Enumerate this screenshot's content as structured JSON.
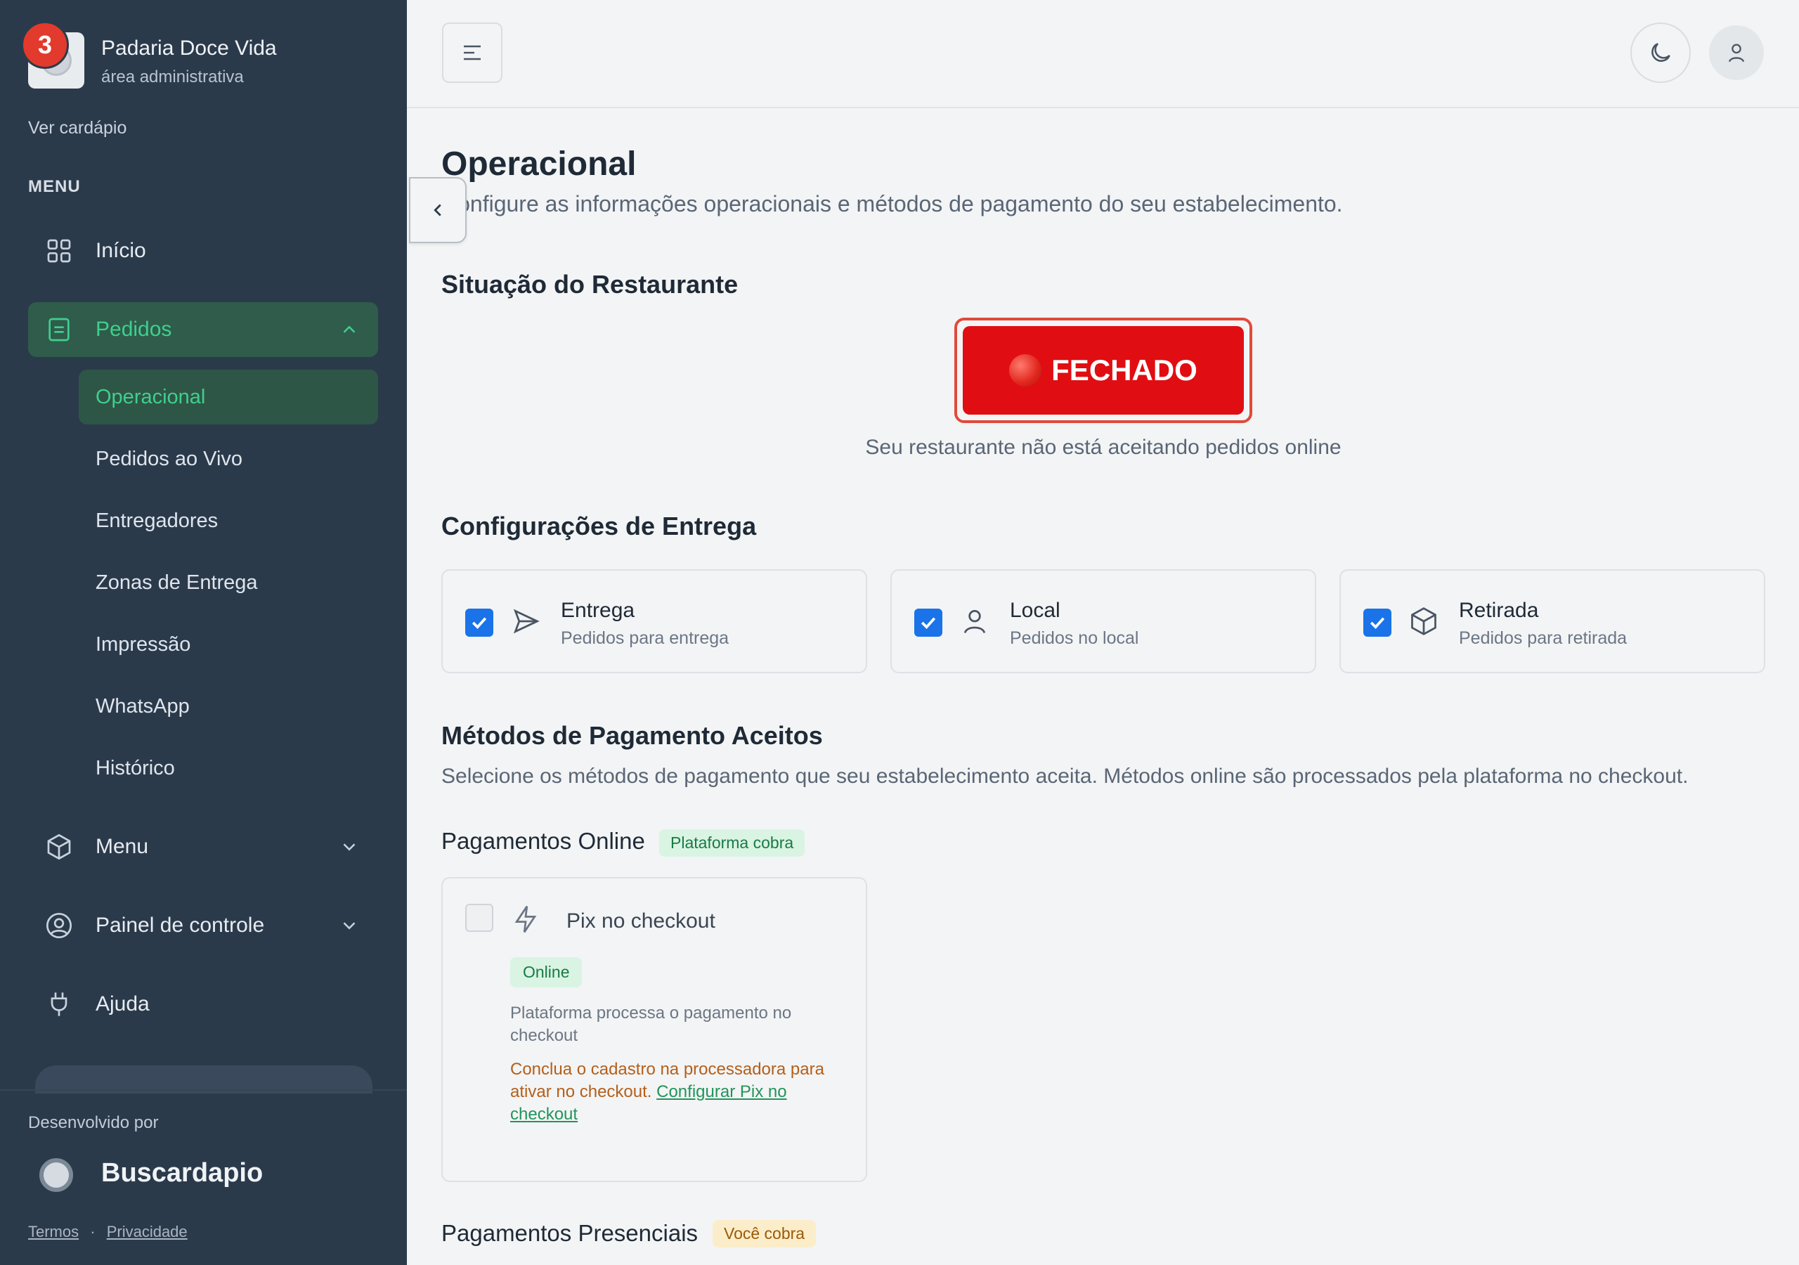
{
  "sidebar": {
    "notification_count": "3",
    "brand_name": "Padaria Doce Vida",
    "brand_subtitle": "área administrativa",
    "view_menu_link": "Ver cardápio",
    "menu_title": "MENU",
    "items": [
      {
        "label": "Início",
        "icon": "grid-icon"
      },
      {
        "label": "Pedidos",
        "icon": "orders-icon",
        "expanded": true
      },
      {
        "label": "Menu",
        "icon": "box-icon"
      },
      {
        "label": "Painel de controle",
        "icon": "user-circle-icon"
      },
      {
        "label": "Ajuda",
        "icon": "plug-icon"
      }
    ],
    "subitems": [
      {
        "label": "Operacional",
        "active": true
      },
      {
        "label": "Pedidos ao Vivo"
      },
      {
        "label": "Entregadores"
      },
      {
        "label": "Zonas de Entrega"
      },
      {
        "label": "Impressão"
      },
      {
        "label": "WhatsApp"
      },
      {
        "label": "Histórico"
      }
    ],
    "developed_by": "Desenvolvido por",
    "developer_name": "Buscardapio",
    "footer_terms": "Termos",
    "footer_sep": "·",
    "footer_privacy": "Privacidade"
  },
  "page": {
    "title": "Operacional",
    "subtitle": "Configure as informações operacionais e métodos de pagamento do seu estabelecimento."
  },
  "status": {
    "section_title": "Situação do Restaurante",
    "button_label": "FECHADO",
    "note": "Seu restaurante não está aceitando pedidos online"
  },
  "delivery": {
    "section_title": "Configurações de Entrega",
    "options": [
      {
        "label": "Entrega",
        "sub": "Pedidos para entrega",
        "checked": true,
        "icon": "send-icon"
      },
      {
        "label": "Local",
        "sub": "Pedidos no local",
        "checked": true,
        "icon": "person-icon"
      },
      {
        "label": "Retirada",
        "sub": "Pedidos para retirada",
        "checked": true,
        "icon": "package-icon"
      }
    ]
  },
  "payments": {
    "section_title": "Métodos de Pagamento Aceitos",
    "subtitle": "Selecione os métodos de pagamento que seu estabelecimento aceita. Métodos online são processados pela plataforma no checkout.",
    "online_title": "Pagamentos Online",
    "online_tag": "Plataforma cobra",
    "pix": {
      "label": "Pix no checkout",
      "checked": false,
      "tag": "Online",
      "description": "Plataforma processa o pagamento no checkout",
      "warning": "Conclua o cadastro na processadora para ativar no checkout.",
      "link": "Configurar Pix no checkout"
    },
    "presential_title": "Pagamentos Presenciais",
    "presential_tag": "Você cobra"
  },
  "colors": {
    "sidebar_bg": "#2b3a4b",
    "accent_green": "#3fcf8e",
    "closed_red": "#e00e12",
    "checkbox_blue": "#1a73e8"
  }
}
